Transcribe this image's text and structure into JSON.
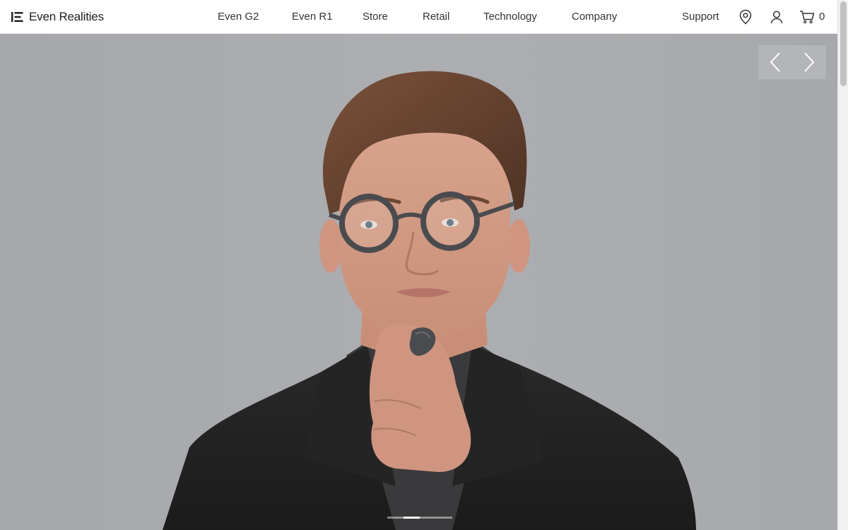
{
  "brand": {
    "name": "Even Realities"
  },
  "nav": {
    "items": [
      {
        "label": "Even G2"
      },
      {
        "label": "Even R1"
      },
      {
        "label": "Store"
      },
      {
        "label": "Retail"
      },
      {
        "label": "Technology"
      },
      {
        "label": "Company"
      }
    ],
    "support_label": "Support",
    "cart_count": "0",
    "icons": [
      "location-pin-icon",
      "user-icon",
      "cart-icon"
    ]
  },
  "hero": {
    "slide_count": 4,
    "active_slide": 2,
    "icons": [
      "chevron-left-icon",
      "chevron-right-icon"
    ]
  },
  "colors": {
    "hero_background": "#a9abae",
    "text": "#333333",
    "jacket": "#1e1e1f"
  }
}
